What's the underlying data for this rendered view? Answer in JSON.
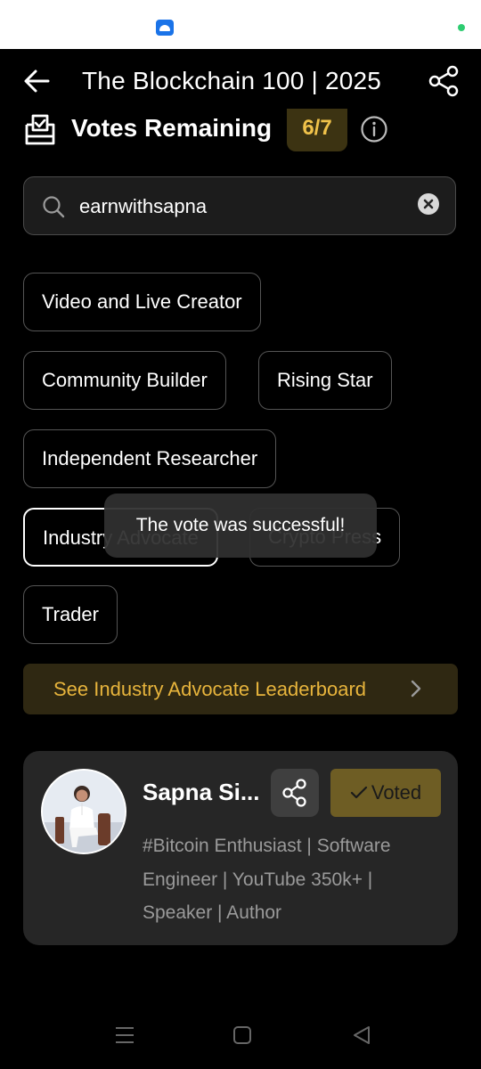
{
  "header": {
    "title": "The Blockchain 100 | 2025",
    "back_icon": "arrow-left-icon",
    "share_icon": "share-icon"
  },
  "votes": {
    "label": "Votes Remaining",
    "count": "6/7",
    "info_icon": "info-icon"
  },
  "search": {
    "value": "earnwithsapna",
    "icon": "search-icon",
    "clear_icon": "clear-icon"
  },
  "categories": [
    {
      "label": "Video and Live Creator",
      "selected": false
    },
    {
      "label": "Community Builder",
      "selected": false
    },
    {
      "label": "Rising Star",
      "selected": false
    },
    {
      "label": "Independent Researcher",
      "selected": false
    },
    {
      "label": "Industry Advocate",
      "selected": true
    },
    {
      "label": "Crypto Press",
      "selected": false
    },
    {
      "label": "Trader",
      "selected": false
    }
  ],
  "toast": {
    "message": "The vote was successful!"
  },
  "leaderboard": {
    "label": "See Industry Advocate Leaderboard"
  },
  "nominee": {
    "name": "Sapna Si...",
    "voted_label": "Voted",
    "bio": "#Bitcoin Enthusiast | Software Engineer | YouTube 350k+ | Speaker | Author"
  },
  "colors": {
    "background": "#000000",
    "accent_gold": "#e7b43c",
    "count_bg": "#3c3312",
    "card_bg": "#262626",
    "voted_bg": "#6e5d24"
  }
}
